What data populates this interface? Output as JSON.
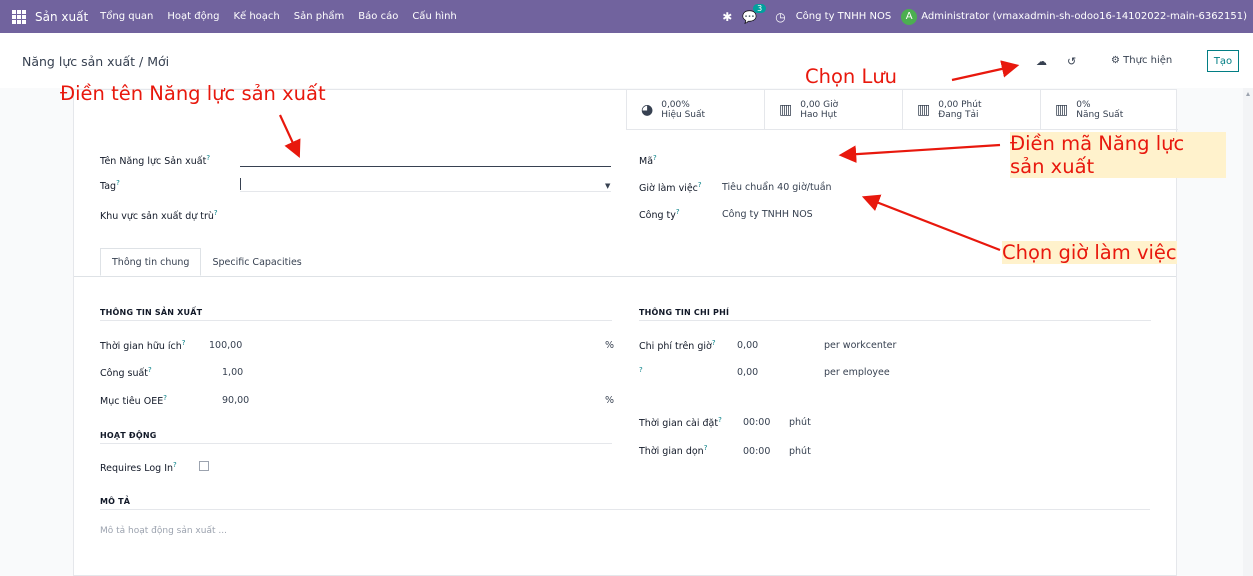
{
  "navbar": {
    "app_name": "Sản xuất",
    "menu": [
      "Tổng quan",
      "Hoạt động",
      "Kế hoạch",
      "Sản phẩm",
      "Báo cáo",
      "Cấu hình"
    ],
    "chat_count": "3",
    "company": "Công ty TNHH NOS",
    "avatar_letter": "A",
    "user": "Administrator (vmaxadmin-sh-odoo16-14102022-main-6362151)"
  },
  "control": {
    "breadcrumb": "Năng lực sản xuất / Mới",
    "actions_label": "Thực hiện",
    "create_label": "Tạo"
  },
  "stats": [
    {
      "value": "0,00%",
      "label": "Hiệu Suất",
      "icon": "pie-chart-icon"
    },
    {
      "value": "0,00 Giờ",
      "label": "Hao Hụt",
      "icon": "bar-chart-icon"
    },
    {
      "value": "0,00 Phút",
      "label": "Đang Tải",
      "icon": "bar-chart-icon"
    },
    {
      "value": "0%",
      "label": "Năng Suất",
      "icon": "bar-chart-icon"
    }
  ],
  "form": {
    "name_label": "Tên Năng lực Sản xuất",
    "tag_label": "Tag",
    "alternative_label": "Khu vực sản xuất dự trù",
    "code_label": "Mã",
    "hours_label": "Giờ làm việc",
    "hours_value": "Tiêu chuẩn 40 giờ/tuần",
    "company_label": "Công ty",
    "company_value": "Công ty TNHH NOS",
    "tip_mark": "?"
  },
  "tabs": [
    "Thông tin chung",
    "Specific Capacities"
  ],
  "production": {
    "title": "THÔNG TIN SẢN XUẤT",
    "efficiency_label": "Thời gian hữu ích",
    "efficiency_value": "100,00",
    "percent": "%",
    "capacity_label": "Công suất",
    "capacity_value": "1,00",
    "oee_label": "Mục tiêu OEE",
    "oee_value": "90,00"
  },
  "activity": {
    "title": "HOẠT ĐỘNG",
    "login_label": "Requires Log In"
  },
  "costs": {
    "title": "THÔNG TIN CHI PHÍ",
    "hour_cost_label": "Chi phí trên giờ",
    "hour_cost_value": "0,00",
    "per_workcenter": "per workcenter",
    "employee_cost_value": "0,00",
    "per_employee": "per employee",
    "setup_label": "Thời gian cài đặt",
    "setup_value": "00:00",
    "cleanup_label": "Thời gian dọn",
    "cleanup_value": "00:00",
    "minutes": "phút"
  },
  "description": {
    "title": "MÔ TẢ",
    "placeholder": "Mô tả hoạt động sản xuất ..."
  },
  "annotations": {
    "fill_name": "Điền tên Năng lực sản xuất",
    "save": "Chọn Lưu",
    "fill_code_1": "Điền mã Năng lực",
    "fill_code_2": "sản xuất",
    "hours": "Chọn giờ làm việc"
  },
  "colors": {
    "navbar": "#71639e",
    "accent": "#017e84",
    "annotation_red": "#e8180d",
    "annotation_bg": "#fff2cc"
  }
}
